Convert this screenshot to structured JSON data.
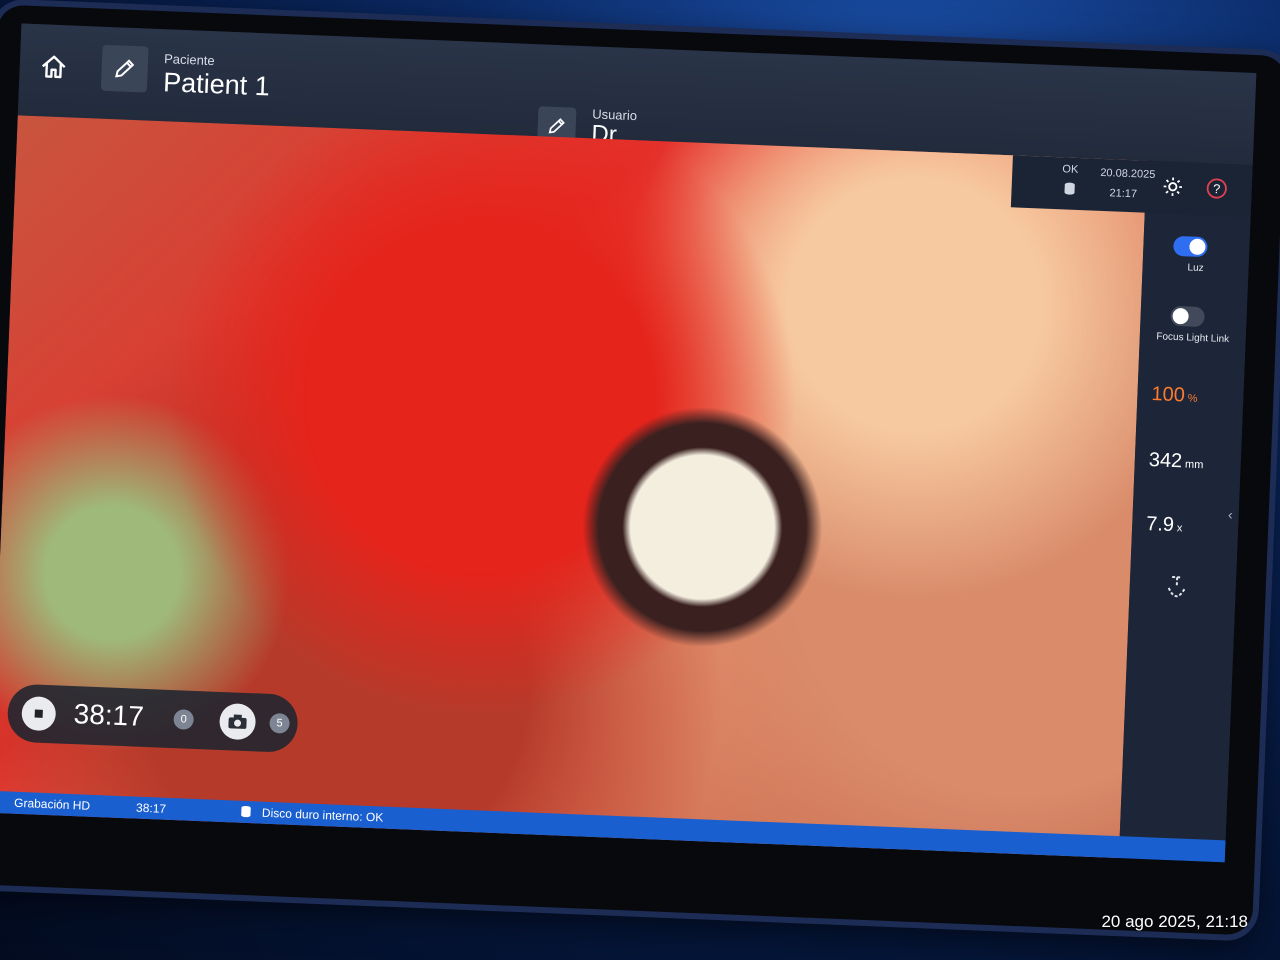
{
  "header": {
    "patient_label": "Paciente",
    "patient_name": "Patient 1",
    "user_label": "Usuario",
    "user_name": "Dr."
  },
  "status": {
    "storage_status": "OK",
    "date": "20.08.2025",
    "time": "21:17"
  },
  "side_panel": {
    "light_label": "Luz",
    "light_on": true,
    "focus_light_link_label": "Focus Light Link",
    "focus_light_link_on": false,
    "zoom_value": "100",
    "zoom_unit": "%",
    "distance_value": "342",
    "distance_unit": "mm",
    "magnification_value": "7.9",
    "magnification_unit": "x"
  },
  "recording": {
    "timer": "38:17",
    "recording_count": "0",
    "photo_count": "5"
  },
  "bottom_bar": {
    "mode": "Grabación HD",
    "elapsed": "38:17",
    "disk_status": "Disco duro interno: OK"
  },
  "photo_timestamp": "20 ago 2025, 21:18",
  "colors": {
    "accent_blue": "#1a5fd0",
    "toggle_on": "#2f6ef0",
    "zoom_orange": "#ff7a2e"
  },
  "icons": [
    "home-icon",
    "pencil-icon",
    "database-icon",
    "gear-icon",
    "help-icon",
    "camera-icon",
    "microscope-tool-icon"
  ]
}
